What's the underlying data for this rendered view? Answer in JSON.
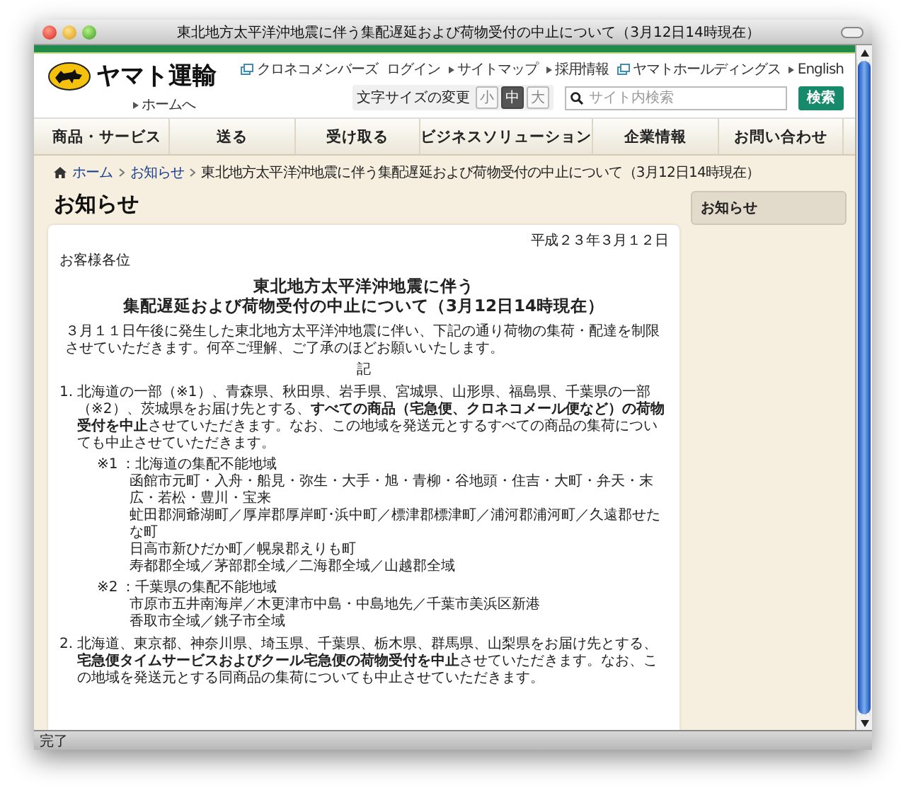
{
  "window": {
    "title": "東北地方太平洋沖地震に伴う集配遅延および荷物受付の中止について（3月12日14時現在）"
  },
  "header": {
    "logo_text": "ヤマト運輸",
    "home_link": "ホームへ",
    "top_links": [
      {
        "label": "クロネコメンバーズ",
        "kind": "external"
      },
      {
        "label": "ログイン",
        "kind": "plain"
      },
      {
        "label": "サイトマップ",
        "kind": "bullet"
      },
      {
        "label": "採用情報",
        "kind": "bullet"
      },
      {
        "label": "ヤマトホールディングス",
        "kind": "external"
      },
      {
        "label": "English",
        "kind": "bullet"
      }
    ],
    "font_size": {
      "label": "文字サイズの変更",
      "options": [
        {
          "label": "小",
          "selected": false
        },
        {
          "label": "中",
          "selected": true
        },
        {
          "label": "大",
          "selected": false
        }
      ]
    },
    "search": {
      "placeholder": "サイト内検索",
      "button": "検索"
    }
  },
  "nav": [
    "商品・サービス",
    "送る",
    "受け取る",
    "ビジネスソリューション",
    "企業情報",
    "お問い合わせ"
  ],
  "breadcrumb": [
    {
      "label": "ホーム",
      "current": false
    },
    {
      "label": "お知らせ",
      "current": false
    },
    {
      "label": "東北地方太平洋沖地震に伴う集配遅延および荷物受付の中止について（3月12日14時現在）",
      "current": true
    }
  ],
  "page_title": "お知らせ",
  "sidebar": {
    "heading": "お知らせ"
  },
  "article": {
    "date": "平成２３年３月１２日",
    "salutation": "お客様各位",
    "title_lines": [
      "東北地方太平洋沖地震に伴う",
      "集配遅延および荷物受付の中止について（3月12日14時現在）"
    ],
    "intro": "３月１１日午後に発生した東北地方太平洋沖地震に伴い、下記の通り荷物の集荷・配達を制限させていただきます。何卒ご理解、ご了承のほどお願いいたします。",
    "ki": "記",
    "items": [
      {
        "number": "1.",
        "text": "北海道の一部（※1）、青森県、秋田県、岩手県、宮城県、山形県、福島県、千葉県の一部（※2）、茨城県をお届け先とする、**すべての商品（宅急便、クロネコメール便など）の荷物受付を中止**させていただきます。なお、この地域を発送元とするすべての商品の集荷についても中止させていただきます。",
        "notes": [
          {
            "mark": "※1",
            "heading": "：北海道の集配不能地域",
            "lines": [
              "函館市元町・入舟・船見・弥生・大手・旭・青柳・谷地頭・住吉・大町・弁天・末広・若松・豊川・宝来",
              "虻田郡洞爺湖町／厚岸郡厚岸町･浜中町／標津郡標津町／浦河郡浦河町／久遠郡せたな町",
              "日高市新ひだか町／幌泉郡えりも町",
              "寿都郡全域／茅部郡全域／二海郡全域／山越郡全域"
            ]
          },
          {
            "mark": "※2",
            "heading": "：千葉県の集配不能地域",
            "lines": [
              "市原市五井南海岸／木更津市中島・中島地先／千葉市美浜区新港",
              "香取市全域／銚子市全域"
            ]
          }
        ]
      },
      {
        "number": "2.",
        "text": "北海道、東京都、神奈川県、埼玉県、千葉県、栃木県、群馬県、山梨県をお届け先とする、**宅急便タイムサービスおよびクール宅急便の荷物受付を中止**させていただきます。なお、この地域を発送元とする同商品の集荷についても中止させていただきます。"
      }
    ]
  },
  "status_bar": "完了"
}
